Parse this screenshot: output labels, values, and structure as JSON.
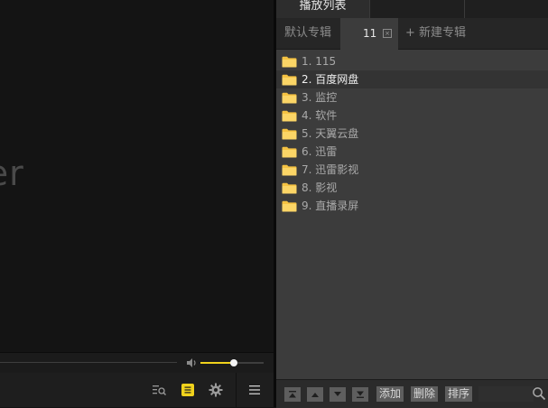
{
  "video": {
    "watermark": "ayer"
  },
  "volume": {
    "level": 0.53,
    "accent": "#f0d21c"
  },
  "controls": {
    "icons": [
      "search-list-icon",
      "playlist-icon",
      "gear-icon",
      "menu-icon"
    ],
    "playlist_icon_color": "#f0d21c"
  },
  "panel": {
    "top_tabs": [
      "播放列表"
    ],
    "album_tabs": {
      "default": "默认专辑",
      "active": "11",
      "close_glyph": "×",
      "new": "+ 新建专辑"
    },
    "items": [
      {
        "label": "1. 115",
        "active": false
      },
      {
        "label": "2. 百度网盘",
        "active": true
      },
      {
        "label": "3. 监控",
        "active": false
      },
      {
        "label": "4. 软件",
        "active": false
      },
      {
        "label": "5. 天翼云盘",
        "active": false
      },
      {
        "label": "6. 迅雷",
        "active": false
      },
      {
        "label": "7. 迅雷影视",
        "active": false
      },
      {
        "label": "8. 影视",
        "active": false
      },
      {
        "label": "9. 直播录屏",
        "active": false
      }
    ],
    "bottom": {
      "add": "添加",
      "delete": "删除",
      "sort": "排序",
      "search_placeholder": ""
    },
    "folder_color": "#f5c242"
  }
}
